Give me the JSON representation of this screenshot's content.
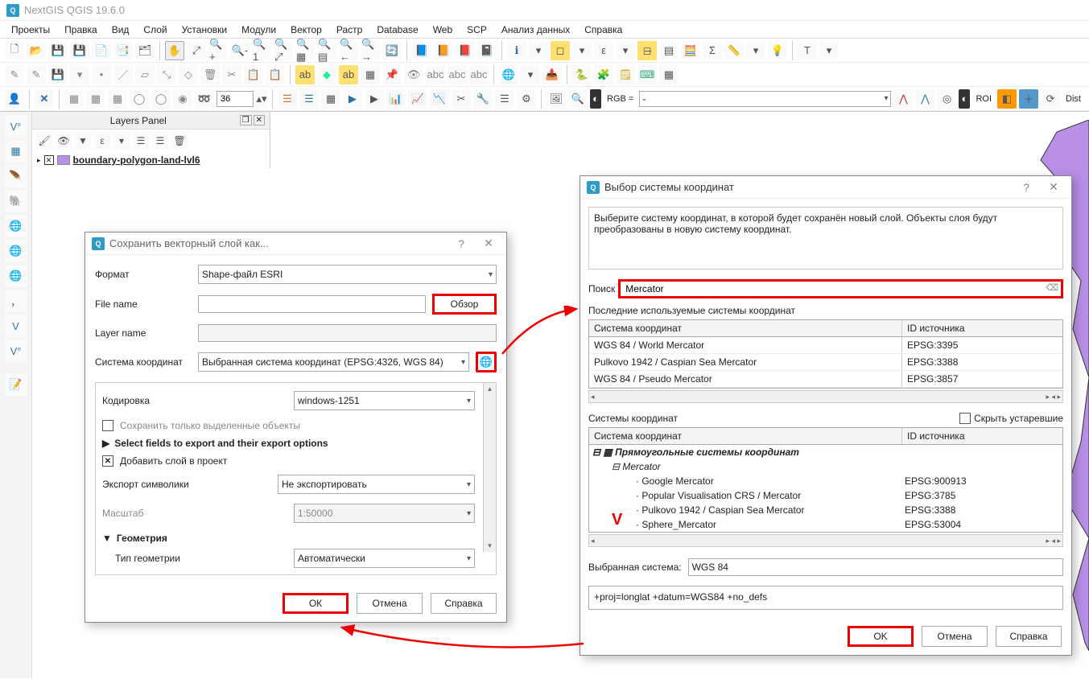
{
  "app": {
    "title": "NextGIS QGIS 19.6.0"
  },
  "menu": {
    "items": [
      "Проекты",
      "Правка",
      "Вид",
      "Слой",
      "Установки",
      "Модули",
      "Вектор",
      "Растр",
      "Database",
      "Web",
      "SCP",
      "Анализ данных",
      "Справка"
    ]
  },
  "toolbar3": {
    "spin_value": "36"
  },
  "status_labels": {
    "rgb": "RGB =",
    "dash": "-",
    "roi": "ROI",
    "dist": "Dist"
  },
  "layers_panel": {
    "title": "Layers Panel",
    "layer_name": "boundary-polygon-land-lvl6"
  },
  "save_dialog": {
    "title": "Сохранить векторный слой как...",
    "format_label": "Формат",
    "format_value": "Shape-файл ESRI",
    "filename_label": "File name",
    "filename_value": "",
    "browse": "Обзор",
    "layername_label": "Layer name",
    "layername_value": "",
    "crs_label": "Система координат",
    "crs_value": "Выбранная система координат (EPSG:4326, WGS 84)",
    "encoding_label": "Кодировка",
    "encoding_value": "windows-1251",
    "save_selected": "Сохранить только выделенные объекты",
    "select_fields": "Select fields to export and their export options",
    "add_layer": "Добавить слой в проект",
    "symbology_label": "Экспорт символики",
    "symbology_value": "Не экспортировать",
    "scale_label": "Масштаб",
    "scale_value": "1:50000",
    "geometry_label": "Геометрия",
    "geom_type_label": "Тип геометрии",
    "geom_type_value": "Автоматически",
    "ok": "ОК",
    "cancel": "Отмена",
    "help": "Справка"
  },
  "crs_dialog": {
    "title": "Выбор системы координат",
    "hint": "Выберите систему координат, в которой будет сохранён новый слой. Объекты слоя будут преобразованы в новую систему координат.",
    "search_label": "Поиск",
    "search_value": "Mercator",
    "recent_label": "Последние используемые системы координат",
    "col_name": "Система координат",
    "col_id": "ID источника",
    "recent": [
      {
        "name": "WGS 84 / World Mercator",
        "id": "EPSG:3395"
      },
      {
        "name": "Pulkovo 1942 / Caspian Sea Mercator",
        "id": "EPSG:3388"
      },
      {
        "name": "WGS 84 / Pseudo Mercator",
        "id": "EPSG:3857"
      }
    ],
    "systems_label": "Системы координат",
    "hide_deprecated": "Скрыть устаревшие",
    "tree_group1": "Прямоугольные системы координат",
    "tree_group2": "Mercator",
    "tree_items": [
      {
        "name": "Google Mercator",
        "id": "EPSG:900913"
      },
      {
        "name": "Popular Visualisation CRS / Mercator",
        "id": "EPSG:3785"
      },
      {
        "name": "Pulkovo 1942 / Caspian Sea Mercator",
        "id": "EPSG:3388"
      },
      {
        "name": "Sphere_Mercator",
        "id": "EPSG:53004"
      }
    ],
    "selected_label": "Выбранная система:",
    "selected_value": "WGS 84",
    "proj_string": "+proj=longlat +datum=WGS84 +no_defs",
    "ok": "OK",
    "cancel": "Отмена",
    "help": "Справка"
  }
}
